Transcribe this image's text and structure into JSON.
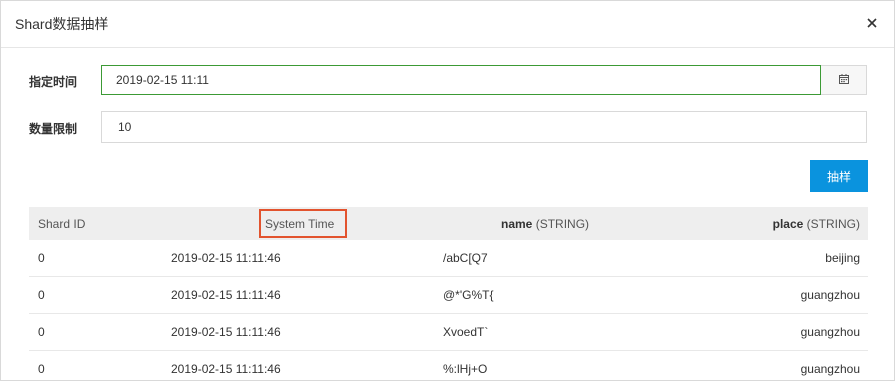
{
  "dialog": {
    "title": "Shard数据抽样"
  },
  "form": {
    "time_label": "指定时间",
    "time_value": "2019-02-15 11:11",
    "count_label": "数量限制",
    "count_value": "10",
    "sample_button": "抽样"
  },
  "table": {
    "headers": {
      "shard_id": "Shard ID",
      "system_time": "System Time",
      "name_bold": "name",
      "name_type": " (STRING)",
      "place_bold": "place",
      "place_type": " (STRING)"
    },
    "rows": [
      {
        "shard_id": "0",
        "system_time": "2019-02-15 11:11:46",
        "name": "/abC[Q7",
        "place": "beijing"
      },
      {
        "shard_id": "0",
        "system_time": "2019-02-15 11:11:46",
        "name": "@*'G%T{",
        "place": "guangzhou"
      },
      {
        "shard_id": "0",
        "system_time": "2019-02-15 11:11:46",
        "name": "XvoedT`",
        "place": "guangzhou"
      },
      {
        "shard_id": "0",
        "system_time": "2019-02-15 11:11:46",
        "name": "%:lHj+O",
        "place": "guangzhou"
      }
    ]
  },
  "colors": {
    "accent": "#0a93de",
    "focus_border": "#3c9a35",
    "highlight": "#e2532e"
  },
  "icons": {
    "close": "close-icon",
    "calendar": "calendar-icon"
  }
}
